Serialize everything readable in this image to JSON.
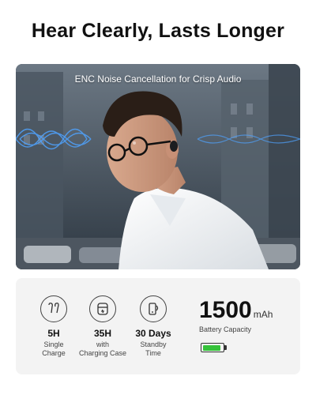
{
  "headline": "Hear Clearly, Lasts Longer",
  "hero": {
    "caption": "ENC Noise Cancellation for Crisp Audio",
    "image": "man-wearing-earbud-city-background"
  },
  "specs": [
    {
      "icon": "earbuds-icon",
      "value": "5H",
      "label": "Single\nCharge"
    },
    {
      "icon": "charging-case-icon",
      "value": "35H",
      "label": "with\nCharging Case"
    },
    {
      "icon": "standby-phone-icon",
      "value": "30 Days",
      "label": "Standby\nTime"
    }
  ],
  "battery": {
    "capacity": "1500",
    "unit": "mAh",
    "label": "Battery Capacity",
    "level": 0.92,
    "fill_color": "#35c23a"
  }
}
